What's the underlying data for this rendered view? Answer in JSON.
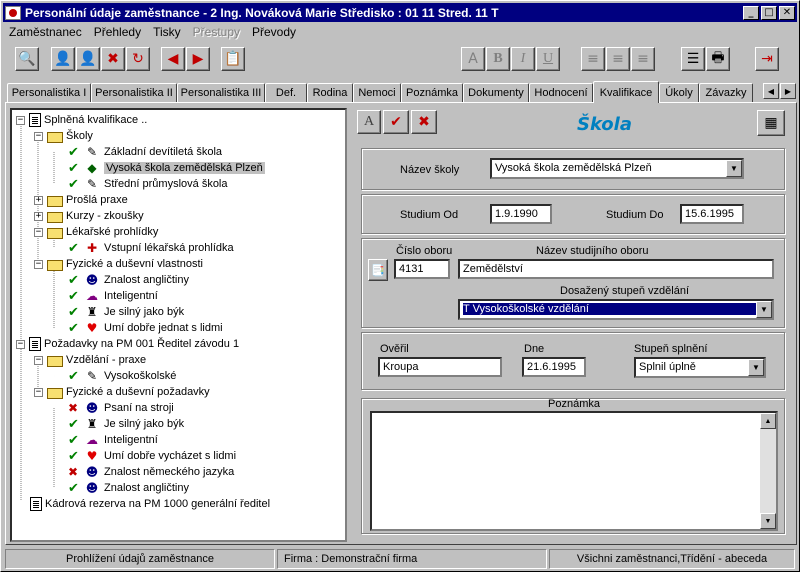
{
  "window": {
    "title": "Personální údaje zaměstnance - 2   Ing. Nováková Marie       Středisko : 01  11 Stred. 11   T",
    "minimize": "_",
    "maximize": "□",
    "close": "✕"
  },
  "menu": [
    {
      "label": "Zaměstnanec",
      "enabled": true
    },
    {
      "label": "Přehledy",
      "enabled": true
    },
    {
      "label": "Tisky",
      "enabled": true
    },
    {
      "label": "Přestupy",
      "enabled": false
    },
    {
      "label": "Převody",
      "enabled": true
    }
  ],
  "tabs": [
    "Personalistika I",
    "Personalistika II",
    "Personalistika III",
    "Def.",
    "Rodina",
    "Nemoci",
    "Poznámka",
    "Dokumenty",
    "Hodnocení",
    "Kvalifikace",
    "Úkoly",
    "Závazky"
  ],
  "active_tab": "Kvalifikace",
  "tree": {
    "root1": "Splněná kvalifikace ..",
    "skoly": "Školy",
    "skoly_items": [
      "Základní devítiletá škola",
      "Vysoká škola zemědělská Plzeň",
      "Střední průmyslová škola"
    ],
    "prosla_praxe": "Prošlá praxe",
    "kurzy": "Kurzy - zkoušky",
    "lekarske": "Lékařské prohlídky",
    "lekarske_items": [
      "Vstupní lékařská prohlídka"
    ],
    "fyzicke": "Fyzické a duševní vlastnosti",
    "fyzicke_items": [
      "Znalost angličtiny",
      "Inteligentní",
      "Je silný jako býk",
      "Umí dobře jednat s lidmi"
    ],
    "root2": "Požadavky na PM 001  Ředitel závodu 1",
    "vzdelani": "Vzdělání - praxe",
    "vzdelani_items": [
      "Vysokoškolské"
    ],
    "fyz_pozadavky": "Fyzické a duševní požadavky",
    "fyz_pozadavky_items": [
      "Psaní na stroji",
      "Je silný jako býk",
      "Inteligentní",
      "Umí dobře vycházet s lidmi",
      "Znalost německého jazyka",
      "Znalost angličtiny"
    ],
    "root3": "Kádrová rezerva na PM 1000  generální ředitel"
  },
  "form": {
    "heading": "Škola",
    "nazev_skoly_label": "Název školy",
    "nazev_skoly_value": "Vysoká škola zemědělská Plzeň",
    "studium_od_label": "Studium  Od",
    "studium_od_value": "1.9.1990",
    "studium_do_label": "Studium  Do",
    "studium_do_value": "15.6.1995",
    "cislo_oboru_label": "Číslo oboru",
    "cislo_oboru_value": "4131",
    "nazev_oboru_label": "Název studijního oboru",
    "nazev_oboru_value": "Zemědělství",
    "stupen_label": "Dosažený stupeň vzdělání",
    "stupen_value": "T   Vysokoškolské vzdělání",
    "overil_label": "Ověřil",
    "overil_value": "Kroupa",
    "dne_label": "Dne",
    "dne_value": "21.6.1995",
    "splneni_label": "Stupeň splnění",
    "splneni_value": "Splnil úplně",
    "poznamka_label": "Poznámka"
  },
  "status": {
    "left": "Prohlížení údajů zaměstnance",
    "middle": "Firma :  Demonstrační firma",
    "right": "Všichni zaměstnanci,Třídění - abeceda"
  }
}
